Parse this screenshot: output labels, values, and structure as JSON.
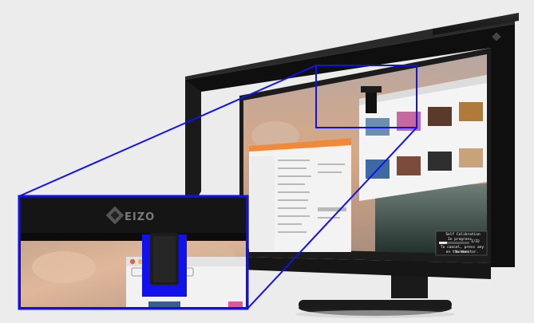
{
  "brand": {
    "logo_text": "EIZO",
    "colors": {
      "highlight": "#1111ee",
      "bezel": "#1d1d1d",
      "hood": "#151515"
    }
  },
  "monitor_osd": {
    "title": "Self Calibration",
    "status": "In progress...",
    "counter": "1/32",
    "message_line1": "To cancel, press any button",
    "message_line2": "on the monitor."
  },
  "callout": {
    "description": "Magnified view of the built-in calibration sensor swung down over the screen"
  }
}
